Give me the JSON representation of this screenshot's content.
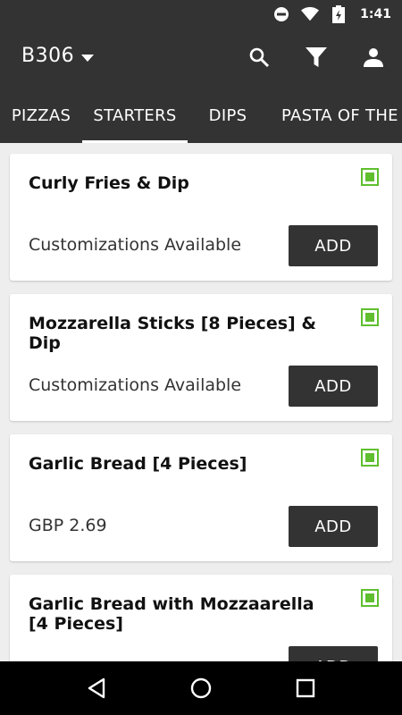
{
  "status_bar": {
    "time": "1:41",
    "icons": [
      "do-not-disturb-icon",
      "wifi-icon",
      "battery-icon"
    ]
  },
  "app_bar": {
    "store": "B306",
    "actions": [
      "search-icon",
      "filter-icon",
      "account-icon"
    ]
  },
  "tabs": [
    {
      "label": "PIZZAS",
      "active": false
    },
    {
      "label": "STARTERS",
      "active": true
    },
    {
      "label": "DIPS",
      "active": false
    },
    {
      "label": "PASTA OF THE D",
      "active": false
    }
  ],
  "menu": {
    "items": [
      {
        "name": "Curly Fries & Dip",
        "detail": "Customizations Available",
        "button": "ADD"
      },
      {
        "name": "Mozzarella Sticks [8 Pieces] & Dip",
        "detail": "Customizations Available",
        "button": "ADD"
      },
      {
        "name": "Garlic Bread [4 Pieces]",
        "detail": "GBP 2.69",
        "button": "ADD"
      },
      {
        "name": "Garlic Bread with Mozzaarella [4 Pieces]",
        "detail": "",
        "button": "ADD"
      }
    ]
  },
  "colors": {
    "bar": "#333333",
    "veg": "#5fbf2f",
    "button": "#333333",
    "background": "#eeeeee"
  },
  "nav_bar": [
    "back-icon",
    "home-icon",
    "recents-icon"
  ]
}
